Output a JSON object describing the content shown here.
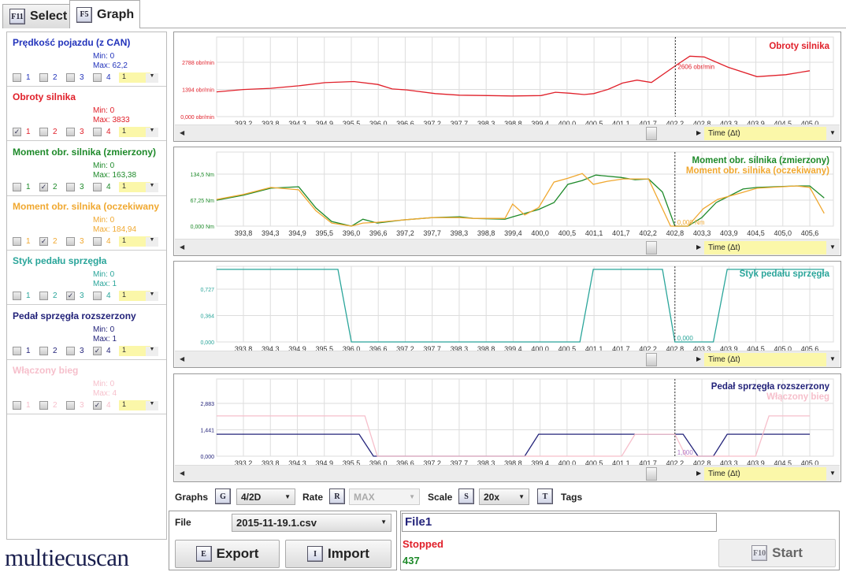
{
  "tabs": [
    {
      "key": "F11",
      "label": "Select"
    },
    {
      "key": "F5",
      "label": "Graph"
    }
  ],
  "colors": {
    "red": "#e0202a",
    "green": "#1e8a2a",
    "orange": "#f0a830",
    "teal": "#2aa59a",
    "navy": "#23237a",
    "blue": "#2233bb",
    "pink": "#f6bfcb"
  },
  "sidebar": [
    {
      "title": "Prędkość pojazdu (z CAN)",
      "color": "#2233bb",
      "min": "Min: 0",
      "max": "Max: 62,2",
      "checks": [
        false,
        false,
        false,
        false
      ],
      "select": "1"
    },
    {
      "title": "Obroty silnika",
      "color": "#e0202a",
      "min": "Min: 0",
      "max": "Max: 3833",
      "checks": [
        true,
        false,
        false,
        false
      ],
      "select": "1"
    },
    {
      "title": "Moment obr. silnika (zmierzony)",
      "color": "#1e8a2a",
      "min": "Min: 0",
      "max": "Max: 163,38",
      "checks": [
        false,
        true,
        false,
        false
      ],
      "select": "1"
    },
    {
      "title": "Moment obr. silnika (oczekiwany",
      "color": "#f0a830",
      "min": "Min: 0",
      "max": "Max: 184,94",
      "checks": [
        false,
        true,
        false,
        false
      ],
      "select": "1"
    },
    {
      "title": "Styk pedału sprzęgła",
      "color": "#2aa59a",
      "min": "Min: 0",
      "max": "Max: 1",
      "checks": [
        false,
        false,
        true,
        false
      ],
      "select": "1"
    },
    {
      "title": "Pedał sprzęgła rozszerzony",
      "color": "#23237a",
      "min": "Min: 0",
      "max": "Max: 1",
      "checks": [
        false,
        false,
        false,
        true
      ],
      "select": "1"
    },
    {
      "title": "Włączony bieg",
      "color": "#f6bfcb",
      "min": "Min: 0",
      "max": "Max: 4",
      "checks": [
        false,
        false,
        false,
        true
      ],
      "select": "1"
    }
  ],
  "check_labels": [
    "1",
    "2",
    "3",
    "4"
  ],
  "scroll": {
    "time_label": "Time (Δt)"
  },
  "chart_data": [
    {
      "type": "line",
      "xticks": [
        "393,2",
        "393,8",
        "394,3",
        "394,9",
        "395,5",
        "396,0",
        "396,6",
        "397,2",
        "397,7",
        "398,3",
        "398,8",
        "399,4",
        "400,0",
        "400,5",
        "401,1",
        "401,7",
        "402,2",
        "402,8",
        "403,3",
        "403,9",
        "404,5",
        "405,0"
      ],
      "xlim_ticks": [
        393.2,
        405.0
      ],
      "yticks": [
        {
          "v": 0,
          "label": "0,000 obr/min"
        },
        {
          "v": 1394,
          "label": "1394 obr/min"
        },
        {
          "v": 2788,
          "label": "2788 obr/min"
        }
      ],
      "ylim": [
        0,
        4081
      ],
      "ytick_color": "#e0202a",
      "cursor": {
        "t": 402.2,
        "label": "2606 obr/min",
        "color": "#e0202a"
      },
      "series": [
        {
          "name": "Obroty silnika",
          "color": "#e0202a",
          "x": [
            392.64,
            393.2,
            393.77,
            394.35,
            394.9,
            395.5,
            396.0,
            396.3,
            396.6,
            397.2,
            397.7,
            398.3,
            398.8,
            399.4,
            399.7,
            400.0,
            400.3,
            400.5,
            400.8,
            401.1,
            401.4,
            401.7,
            402.2,
            402.5,
            402.8,
            403.3,
            403.9,
            404.5,
            405.0
          ],
          "y": [
            1270,
            1390,
            1450,
            1580,
            1740,
            1800,
            1650,
            1420,
            1370,
            1180,
            1100,
            1080,
            1060,
            1080,
            1250,
            1200,
            1130,
            1180,
            1400,
            1720,
            1870,
            1750,
            2606,
            3100,
            3060,
            2530,
            2050,
            2150,
            2350
          ]
        }
      ]
    },
    {
      "type": "line",
      "xticks": [
        "393,8",
        "394,3",
        "394,9",
        "395,5",
        "396,0",
        "396,6",
        "397,2",
        "397,7",
        "398,3",
        "398,8",
        "399,4",
        "400,0",
        "400,5",
        "401,1",
        "401,7",
        "402,2",
        "402,8",
        "403,3",
        "403,9",
        "404,5",
        "405,0",
        "405,6"
      ],
      "xlim_ticks": [
        393.8,
        405.6
      ],
      "yticks": [
        {
          "v": 0,
          "label": "0,000 Nm"
        },
        {
          "v": 67.25,
          "label": "67,25 Nm"
        },
        {
          "v": 134.5,
          "label": "134,5 Nm"
        }
      ],
      "ylim": [
        0,
        191.6
      ],
      "ytick_color": "#1e8a2a",
      "cursor": {
        "t": 402.79,
        "label": "0,000 Nm",
        "color": "#f0a830"
      },
      "series": [
        {
          "name": "Moment obr. silnika (zmierzony)",
          "color": "#1e8a2a",
          "x": [
            393.24,
            393.8,
            394.37,
            394.95,
            395.31,
            395.64,
            396.05,
            396.29,
            396.59,
            397.12,
            397.74,
            398.31,
            398.59,
            399.25,
            399.41,
            399.95,
            400.27,
            400.56,
            400.86,
            401.14,
            401.66,
            401.96,
            402.24,
            402.53,
            402.79,
            403.06,
            403.35,
            403.65,
            404.21,
            404.5,
            405.32,
            405.6,
            405.9
          ],
          "y": [
            67,
            80,
            98,
            102,
            47,
            12,
            0,
            18,
            8,
            16,
            22,
            24,
            20,
            18,
            24,
            43,
            61,
            108,
            118,
            132,
            126,
            120,
            122,
            88,
            0,
            0,
            22,
            61,
            96,
            100,
            104,
            104,
            73
          ]
        },
        {
          "name": "Moment obr. silnika (oczekiwany)",
          "color": "#f0a830",
          "x": [
            393.24,
            393.8,
            394.37,
            394.95,
            395.31,
            395.64,
            396.05,
            396.29,
            396.59,
            397.12,
            397.74,
            398.31,
            398.59,
            399.25,
            399.41,
            399.66,
            399.95,
            400.27,
            400.56,
            400.86,
            401.09,
            401.38,
            401.71,
            402.24,
            402.7,
            403.06,
            403.38,
            403.68,
            404.17,
            404.5,
            405.32,
            405.6,
            405.9
          ],
          "y": [
            69,
            82,
            100,
            94,
            40,
            8,
            0,
            8,
            10,
            16,
            22,
            22,
            20,
            20,
            57,
            29,
            48,
            114,
            124,
            136,
            108,
            116,
            122,
            122,
            0,
            0,
            45,
            69,
            86,
            98,
            104,
            100,
            33
          ]
        }
      ]
    },
    {
      "type": "line",
      "xticks": [
        "393,8",
        "394,3",
        "394,9",
        "395,5",
        "396,0",
        "396,6",
        "397,2",
        "397,7",
        "398,3",
        "398,8",
        "399,4",
        "400,0",
        "400,5",
        "401,1",
        "401,7",
        "402,2",
        "402,8",
        "403,3",
        "403,9",
        "404,5",
        "405,0",
        "405,6"
      ],
      "xlim_ticks": [
        393.8,
        405.6
      ],
      "yticks": [
        {
          "v": 0,
          "label": "0,000"
        },
        {
          "v": 0.364,
          "label": "0,364"
        },
        {
          "v": 0.727,
          "label": "0,727"
        }
      ],
      "ylim": [
        0,
        1.042
      ],
      "ytick_color": "#2aa59a",
      "cursor": {
        "t": 402.79,
        "label": "0,000",
        "color": "#2aa59a"
      },
      "series": [
        {
          "name": "Styk pedału sprzęgła",
          "color": "#2aa59a",
          "x": [
            393.24,
            395.77,
            396.05,
            400.81,
            401.09,
            402.53,
            402.79,
            403.59,
            403.88,
            405.9
          ],
          "y": [
            1,
            1,
            0,
            0,
            1,
            1,
            0,
            0,
            1,
            1
          ]
        }
      ]
    },
    {
      "type": "line",
      "xticks": [
        "393,2",
        "393,8",
        "394,3",
        "394,9",
        "395,5",
        "396,0",
        "396,6",
        "397,2",
        "397,7",
        "398,3",
        "398,8",
        "399,4",
        "400,0",
        "400,5",
        "401,1",
        "401,7",
        "402,2",
        "402,8",
        "403,3",
        "403,9",
        "404,5",
        "405,0"
      ],
      "xlim_ticks": [
        393.2,
        405.0
      ],
      "yticks": [
        {
          "v": 0,
          "label": "0,000"
        },
        {
          "v": 1.441,
          "label": "1,441"
        },
        {
          "v": 2.883,
          "label": "2,883"
        }
      ],
      "ylim": [
        0,
        4.217
      ],
      "ytick_color": "#23237a",
      "cursor": {
        "t": 402.19,
        "label": "1,000",
        "color": "#b07ac8"
      },
      "series": [
        {
          "name": "Pedał sprzęgła rozszerzony",
          "color": "#23237a",
          "x": [
            392.64,
            395.61,
            395.91,
            399.06,
            399.35,
            402.36,
            402.67,
            402.99,
            403.28,
            405.0
          ],
          "y": [
            1.2,
            1.2,
            0,
            0,
            1.2,
            1.2,
            0,
            0,
            1.2,
            1.2
          ]
        },
        {
          "name": "Włączony bieg",
          "color": "#f6bfcb",
          "x": [
            392.64,
            395.73,
            395.99,
            401.08,
            401.36,
            402.19,
            402.42,
            403.87,
            404.15,
            405.0
          ],
          "y": [
            2.2,
            2.2,
            0,
            0,
            1.2,
            1.2,
            0,
            0,
            2.2,
            2.2
          ]
        }
      ]
    }
  ],
  "toolbar": {
    "graphs_label": "Graphs",
    "graphs_key": "G",
    "graphs_value": "4/2D",
    "rate_label": "Rate",
    "rate_key": "R",
    "rate_value": "MAX",
    "scale_label": "Scale",
    "scale_key": "S",
    "scale_value": "20x",
    "tags_key": "T",
    "tags_label": "Tags"
  },
  "file": {
    "label": "File",
    "value": "2015-11-19.1.csv",
    "export_key": "E",
    "export_label": "Export",
    "import_key": "I",
    "import_label": "Import"
  },
  "session": {
    "name": "File1",
    "status": "Stopped",
    "count": "437",
    "start_key": "F10",
    "start_label": "Start"
  },
  "logo": "multiecuscan"
}
